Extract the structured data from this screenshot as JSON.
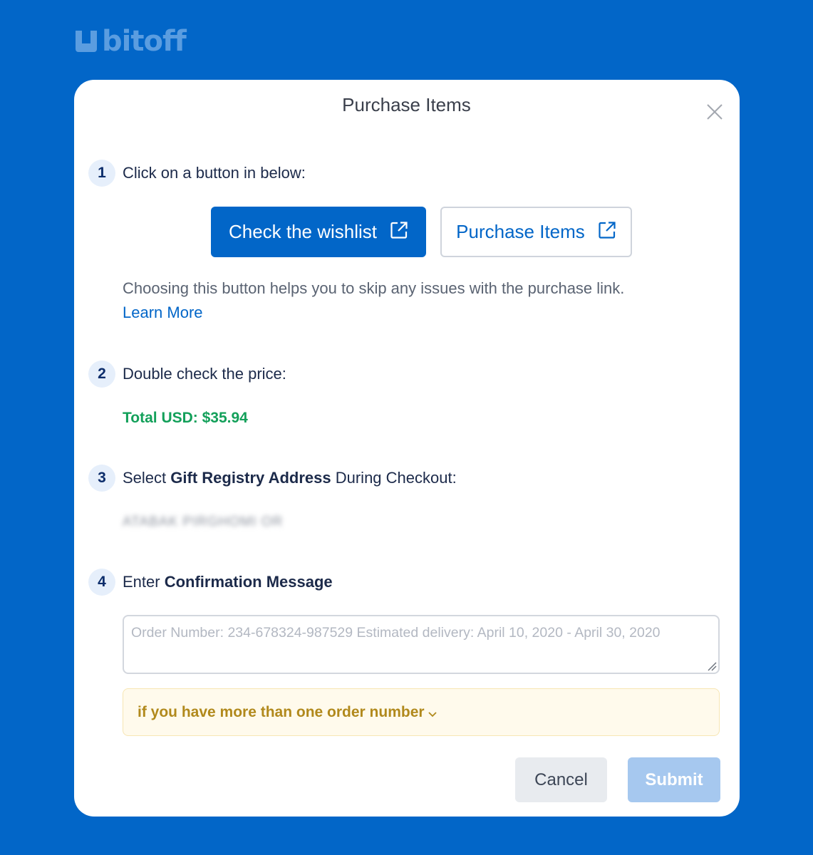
{
  "brand": {
    "logo_text": "bitoff",
    "logo_color": "#5b9de0"
  },
  "colors": {
    "background": "#0266c8",
    "accent": "#0266c8",
    "success": "#13a05a",
    "warning_text": "#b1891c"
  },
  "modal": {
    "title": "Purchase Items",
    "close_icon": "close-icon"
  },
  "steps": [
    {
      "number": "1",
      "text": "Click on a button in below:"
    },
    {
      "number": "2",
      "text": "Double check the price:"
    },
    {
      "number": "3",
      "text_pre": "Select ",
      "text_bold": "Gift Registry Address",
      "text_post": " During Checkout:"
    },
    {
      "number": "4",
      "text_pre": "Enter ",
      "text_bold": "Confirmation Message"
    }
  ],
  "buttons": {
    "wishlist_label": "Check the wishlist",
    "purchase_label": "Purchase Items",
    "external_icon": "external-link-icon",
    "cancel_label": "Cancel",
    "submit_label": "Submit"
  },
  "hint": {
    "text": "Choosing this button helps you to skip any issues with the purchase link.",
    "learn_more": "Learn More"
  },
  "price": {
    "total": "Total USD: $35.94"
  },
  "address": {
    "value": "ATABAK PIRGHOMI OR"
  },
  "confirmation": {
    "value": "",
    "placeholder": "Order Number: 234-678324-987529 Estimated delivery: April 10, 2020 - April 30, 2020"
  },
  "collapse": {
    "label": "if you have more than one order number"
  }
}
